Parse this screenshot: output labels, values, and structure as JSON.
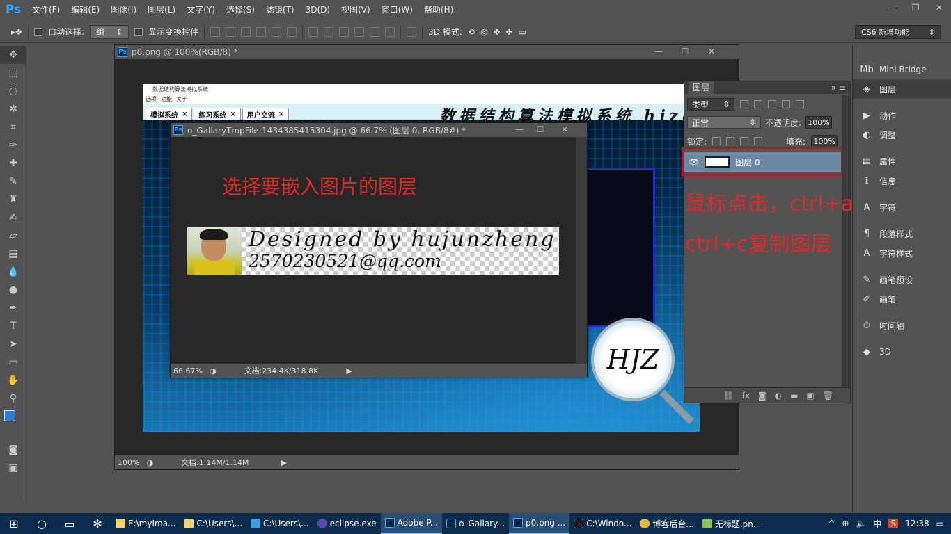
{
  "menubar": {
    "logo": "Ps",
    "items": [
      "文件(F)",
      "编辑(E)",
      "图像(I)",
      "图层(L)",
      "文字(Y)",
      "选择(S)",
      "滤镜(T)",
      "3D(D)",
      "视图(V)",
      "窗口(W)",
      "帮助(H)"
    ],
    "window_controls": [
      "—",
      "❐",
      "✕"
    ]
  },
  "options": {
    "auto_select_label": "自动选择:",
    "auto_select_value": "组",
    "show_transform_label": "显示变换控件",
    "mode_3d_label": "3D 模式:",
    "workspace": "CS6 新增功能"
  },
  "doc_p0": {
    "title": "p0.png @ 100%(RGB/8) *",
    "zoom": "100%",
    "doc_size": "文档:1.14M/1.14M"
  },
  "embedded_app": {
    "title": "数据结构算法模拟系统",
    "menu": [
      "选项",
      "功能",
      "关于"
    ],
    "tabs": [
      "模拟系统",
      "练习系统",
      "用户交流"
    ],
    "banner": "数据结构算法模拟系统 hjzg",
    "logo_text": "HJZ"
  },
  "doc_gallery": {
    "title": "o_GallaryTmpFile-1434385415304.jpg @ 66.7% (图层 0, RGB/8#) *",
    "zoom": "66.67%",
    "doc_size": "文档:234.4K/318.8K",
    "annotation": "选择要嵌入图片的图层",
    "signature_line1": "Designed by  hujunzheng",
    "signature_line2": "2570230521@qq.com"
  },
  "layers_panel": {
    "tab": "图层",
    "filter_kind": "类型",
    "blend_mode": "正常",
    "opacity_label": "不透明度:",
    "opacity_value": "100%",
    "lock_label": "锁定:",
    "fill_label": "填充:",
    "fill_value": "100%",
    "layer_name": "图层 0"
  },
  "annotations": {
    "line1": "鼠标点击，ctrl+a",
    "line2": "ctrl+c复制图层"
  },
  "dock": {
    "items": [
      {
        "icon": "Mb",
        "label": "Mini Bridge"
      },
      {
        "icon": "◈",
        "label": "图层"
      },
      {
        "icon": "▶",
        "label": "动作"
      },
      {
        "icon": "◐",
        "label": "调整"
      },
      {
        "icon": "▤",
        "label": "属性"
      },
      {
        "icon": "ℹ",
        "label": "信息"
      },
      {
        "icon": "A",
        "label": "字符"
      },
      {
        "icon": "¶",
        "label": "段落样式"
      },
      {
        "icon": "A",
        "label": "字符样式"
      },
      {
        "icon": "✎",
        "label": "画笔预设"
      },
      {
        "icon": "✐",
        "label": "画笔"
      },
      {
        "icon": "⏱",
        "label": "时间轴"
      },
      {
        "icon": "◆",
        "label": "3D"
      }
    ]
  },
  "taskbar": {
    "items": [
      "E:\\myIma...",
      "C:\\Users\\...",
      "C:\\Users\\...",
      "eclipse.exe",
      "Adobe P...",
      "o_Gallary...",
      "p0.png ...",
      "C:\\Windo...",
      "博客后台...",
      "无标题.pn..."
    ],
    "tray_ime": "中",
    "clock": "12:38"
  }
}
